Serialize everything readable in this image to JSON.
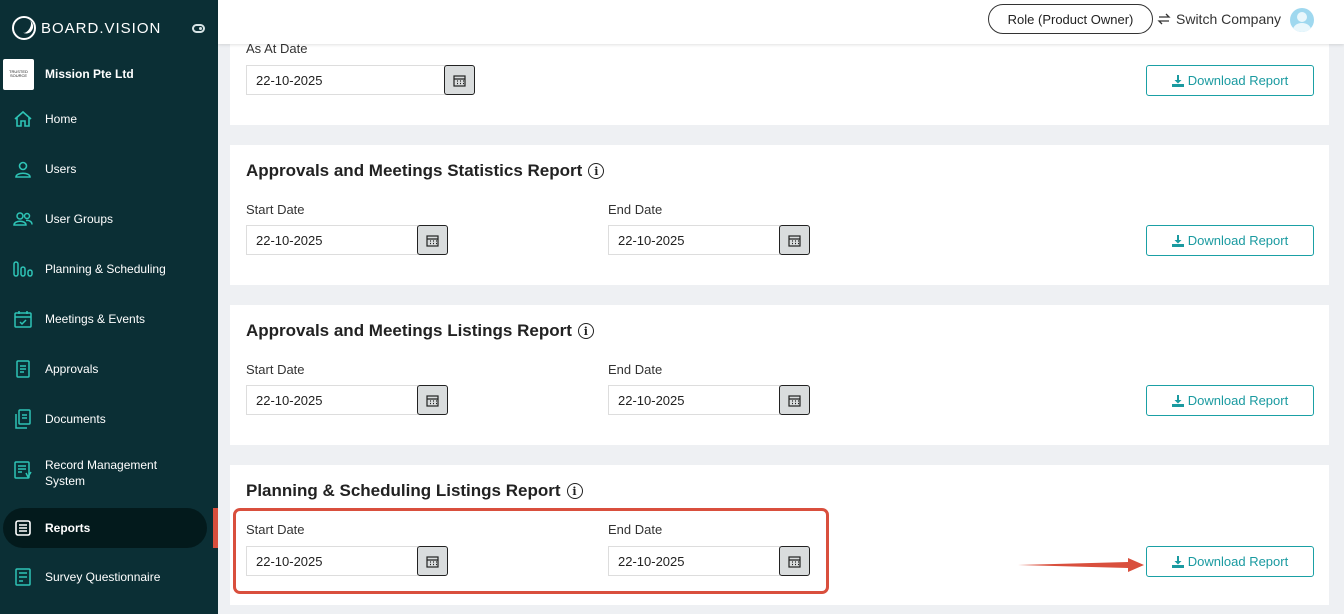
{
  "app": {
    "brand": "BOARD.VISION",
    "company_logo_text": "TRUSTED SOURCE",
    "company_name": "Mission Pte Ltd"
  },
  "colors": {
    "sidebar_bg": "#0b2f35",
    "accent": "#1aa0a5",
    "highlight": "#d94f3d"
  },
  "sidebar": {
    "items": [
      {
        "label": "Home",
        "icon": "home-icon"
      },
      {
        "label": "Users",
        "icon": "user-icon"
      },
      {
        "label": "User Groups",
        "icon": "user-group-icon"
      },
      {
        "label": "Planning & Scheduling",
        "icon": "planning-icon"
      },
      {
        "label": "Meetings & Events",
        "icon": "calendar-check-icon"
      },
      {
        "label": "Approvals",
        "icon": "approval-document-icon"
      },
      {
        "label": "Documents",
        "icon": "documents-icon"
      },
      {
        "label": "Record Management System",
        "icon": "record-management-icon"
      },
      {
        "label": "Reports",
        "icon": "reports-icon",
        "active": true
      },
      {
        "label": "Survey Questionnaire",
        "icon": "survey-icon"
      }
    ]
  },
  "header": {
    "role": "Role (Product Owner)",
    "switch_company": "Switch Company"
  },
  "cards": [
    {
      "title": "",
      "start_label": "As At Date",
      "start_value": "22-10-2025",
      "download": "Download Report"
    },
    {
      "title": "Approvals and Meetings Statistics Report",
      "start_label": "Start Date",
      "start_value": "22-10-2025",
      "end_label": "End Date",
      "end_value": "22-10-2025",
      "download": "Download Report"
    },
    {
      "title": "Approvals and Meetings Listings Report",
      "start_label": "Start Date",
      "start_value": "22-10-2025",
      "end_label": "End Date",
      "end_value": "22-10-2025",
      "download": "Download Report"
    },
    {
      "title": "Planning & Scheduling Listings Report",
      "start_label": "Start Date",
      "start_value": "22-10-2025",
      "end_label": "End Date",
      "end_value": "22-10-2025",
      "download": "Download Report"
    }
  ]
}
